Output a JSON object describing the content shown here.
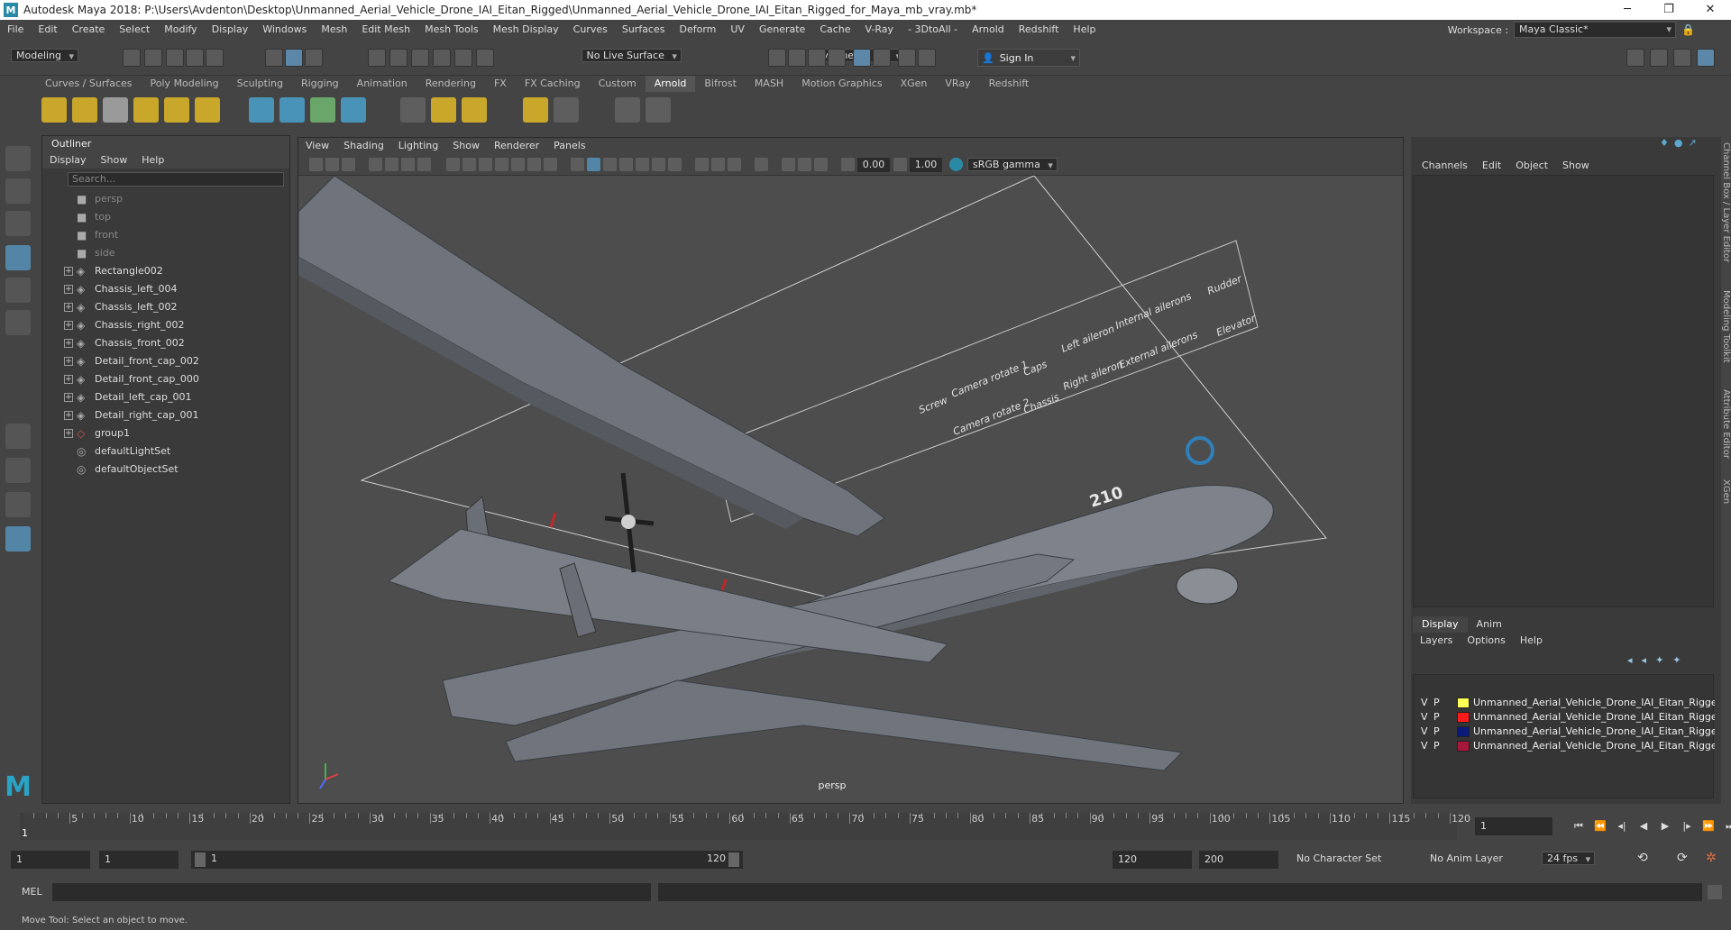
{
  "title_bar": {
    "app_title": "Autodesk Maya 2018: P:\\Users\\Avdenton\\Desktop\\Unmanned_Aerial_Vehicle_Drone_IAI_Eitan_Rigged\\Unmanned_Aerial_Vehicle_Drone_IAI_Eitan_Rigged_for_Maya_mb_vray.mb*",
    "minimize": "─",
    "maximize": "❐",
    "close": "✕"
  },
  "menu": [
    "File",
    "Edit",
    "Create",
    "Select",
    "Modify",
    "Display",
    "Windows",
    "Mesh",
    "Edit Mesh",
    "Mesh Tools",
    "Mesh Display",
    "Curves",
    "Surfaces",
    "Deform",
    "UV",
    "Generate",
    "Cache",
    "V-Ray",
    "- 3DtoAll -",
    "Arnold",
    "Redshift",
    "Help"
  ],
  "workspace": {
    "label": "Workspace :",
    "value": "Maya Classic*"
  },
  "status_line": {
    "mode": "Modeling",
    "live_surface": "No Live Surface",
    "symmetry": "Symmetry: Off",
    "sign_in": "Sign In"
  },
  "shelf_tabs": [
    "Curves / Surfaces",
    "Poly Modeling",
    "Sculpting",
    "Rigging",
    "Animation",
    "Rendering",
    "FX",
    "FX Caching",
    "Custom",
    "Arnold",
    "Bifrost",
    "MASH",
    "Motion Graphics",
    "XGen",
    "VRay",
    "Redshift"
  ],
  "shelf_active": "Arnold",
  "outliner": {
    "title": "Outliner",
    "menu": [
      "Display",
      "Show",
      "Help"
    ],
    "search_placeholder": "Search...",
    "items": [
      {
        "name": "persp",
        "type": "camera"
      },
      {
        "name": "top",
        "type": "camera"
      },
      {
        "name": "front",
        "type": "camera"
      },
      {
        "name": "side",
        "type": "camera"
      },
      {
        "name": "Rectangle002",
        "type": "transform"
      },
      {
        "name": "Chassis_left_004",
        "type": "transform"
      },
      {
        "name": "Chassis_left_002",
        "type": "transform"
      },
      {
        "name": "Chassis_right_002",
        "type": "transform"
      },
      {
        "name": "Chassis_front_002",
        "type": "transform"
      },
      {
        "name": "Detail_front_cap_002",
        "type": "transform"
      },
      {
        "name": "Detail_front_cap_000",
        "type": "transform"
      },
      {
        "name": "Detail_left_cap_001",
        "type": "transform"
      },
      {
        "name": "Detail_right_cap_001",
        "type": "transform"
      },
      {
        "name": "group1",
        "type": "group"
      },
      {
        "name": "defaultLightSet",
        "type": "set"
      },
      {
        "name": "defaultObjectSet",
        "type": "set"
      }
    ]
  },
  "viewport": {
    "menu": [
      "View",
      "Shading",
      "Lighting",
      "Show",
      "Renderer",
      "Panels"
    ],
    "exposure": "0.00",
    "gamma": "1.00",
    "color_space": "sRGB gamma",
    "camera_label": "persp",
    "rig_labels": {
      "rudder": "Rudder",
      "elevator": "Elevator",
      "internal_ailerons": "Internal ailerons",
      "external_ailerons": "External ailerons",
      "left_aileron": "Left aileron",
      "right_aileron": "Right aileron",
      "caps": "Caps",
      "chassis": "Chassis",
      "camera_rotate_1": "Camera rotate 1",
      "camera_rotate_2": "Camera rotate 2",
      "screw": "Screw"
    },
    "tail_number": "210"
  },
  "channel_box": {
    "menu": [
      "Channels",
      "Edit",
      "Object",
      "Show"
    ],
    "tabs": [
      "Display",
      "Anim"
    ],
    "active_tab": "Display",
    "layer_menu": [
      "Layers",
      "Options",
      "Help"
    ],
    "layers": [
      {
        "v": "V",
        "p": "P",
        "color": "#ffff55",
        "name": "Unmanned_Aerial_Vehicle_Drone_IAI_Eitan_Rigged_l"
      },
      {
        "v": "V",
        "p": "P",
        "color": "#ff1a1a",
        "name": "Unmanned_Aerial_Vehicle_Drone_IAI_Eitan_Rigged_("
      },
      {
        "v": "V",
        "p": "P",
        "color": "#0b1a78",
        "name": "Unmanned_Aerial_Vehicle_Drone_IAI_Eitan_Rigged_l"
      },
      {
        "v": "V",
        "p": "P",
        "color": "#a8163c",
        "name": "Unmanned_Aerial_Vehicle_Drone_IAI_Eitan_Rigged_("
      }
    ]
  },
  "side_tabs": [
    "Channel Box / Layer Editor",
    "Modeling Toolkit",
    "Attribute Editor",
    "XGen"
  ],
  "timeline": {
    "ticks": [
      "5",
      "10",
      "15",
      "20",
      "25",
      "30",
      "35",
      "40",
      "45",
      "50",
      "55",
      "60",
      "65",
      "70",
      "75",
      "80",
      "85",
      "90",
      "95",
      "100",
      "105",
      "110",
      "115",
      "120"
    ],
    "current_frame": "1",
    "playhead": "1"
  },
  "range": {
    "start": "1",
    "start2": "1",
    "slider_start": "1",
    "slider_end": "120",
    "end": "120",
    "end2": "200",
    "character_set": "No Character Set",
    "anim_layer": "No Anim Layer",
    "fps": "24 fps"
  },
  "command_line": {
    "label": "MEL"
  },
  "help_line": "Move Tool: Select an object to move."
}
